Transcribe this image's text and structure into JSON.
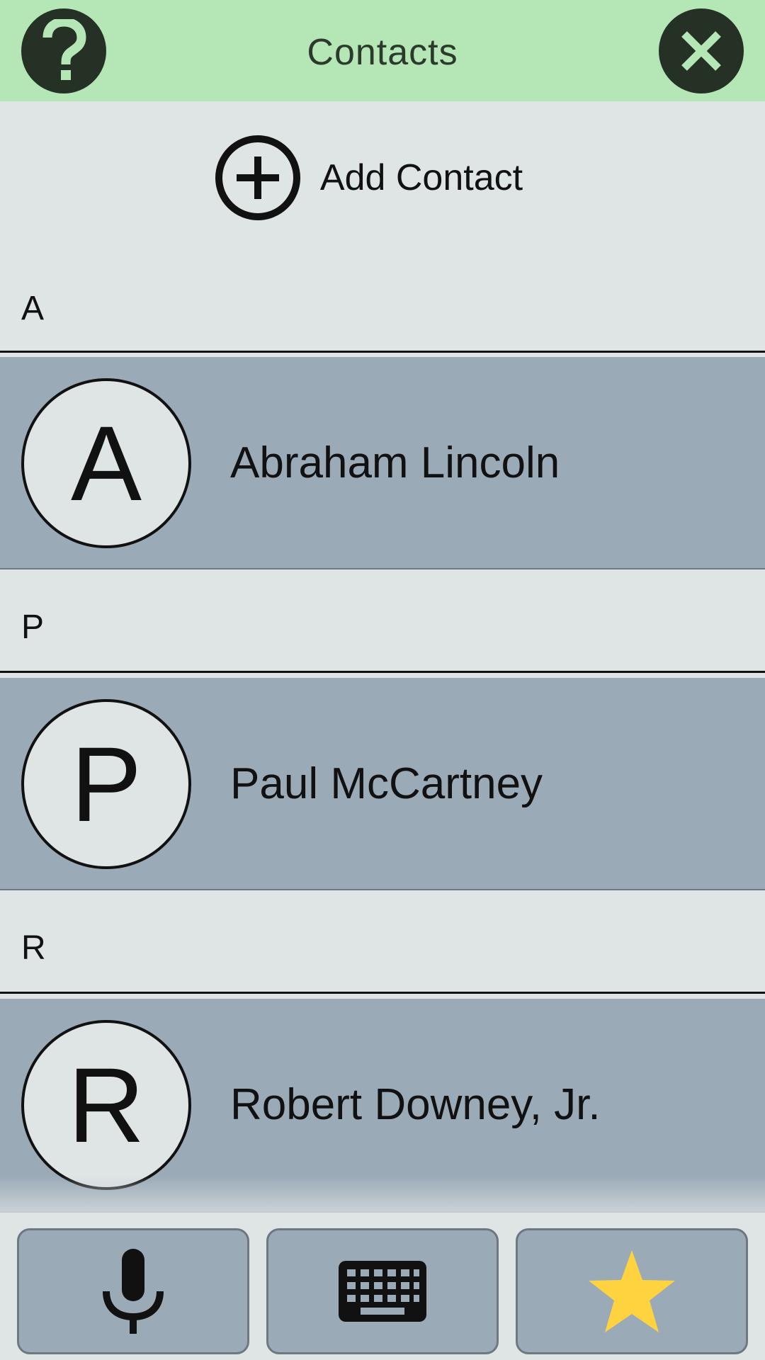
{
  "header": {
    "title": "Contacts",
    "help_icon": "question-mark-icon",
    "close_icon": "close-x-icon",
    "background": "#b5e6b6"
  },
  "add_contact": {
    "label": "Add Contact",
    "icon": "plus-circle-icon"
  },
  "contacts": [
    {
      "section": "A",
      "initial": "A",
      "name": "Abraham Lincoln"
    },
    {
      "section": "P",
      "initial": "P",
      "name": "Paul McCartney"
    },
    {
      "section": "R",
      "initial": "R",
      "name": "Robert Downey, Jr."
    }
  ],
  "toolbar": {
    "items": [
      {
        "name": "microphone",
        "icon": "microphone-icon"
      },
      {
        "name": "keyboard",
        "icon": "keyboard-icon"
      },
      {
        "name": "favorites",
        "icon": "star-icon",
        "color": "#ffd23f"
      }
    ]
  },
  "colors": {
    "row_background": "#9aabb7",
    "page_background": "#dfe4e5",
    "star": "#ffd23f"
  }
}
